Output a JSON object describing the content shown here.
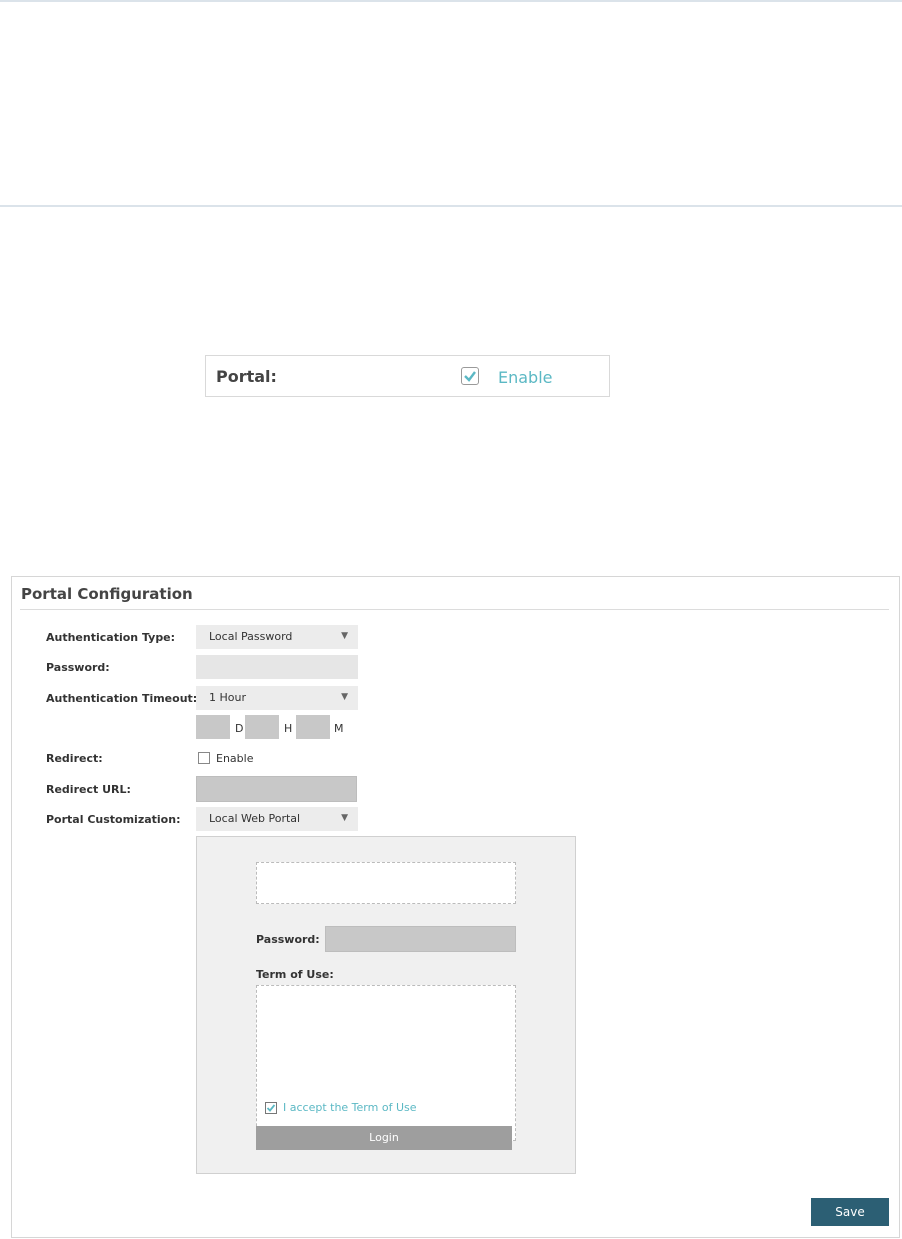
{
  "portal_toggle": {
    "label": "Portal:",
    "checkbox_label": "Enable",
    "checked": true
  },
  "config": {
    "title": "Portal Configuration",
    "fields": {
      "auth_type_label": "Authentication Type:",
      "auth_type_value": "Local Password",
      "password_label": "Password:",
      "password_value": "",
      "timeout_label": "Authentication Timeout:",
      "timeout_value": "1 Hour",
      "unit_d": "D",
      "unit_h": "H",
      "unit_m": "M",
      "redirect_label": "Redirect:",
      "redirect_checkbox_label": "Enable",
      "redirect_checked": false,
      "redirect_url_label": "Redirect URL:",
      "redirect_url_value": "",
      "portal_custom_label": "Portal Customization:",
      "portal_custom_value": "Local Web Portal"
    },
    "preview": {
      "password_label": "Password:",
      "term_label": "Term of Use:",
      "accept_label": "I accept the Term of Use",
      "accept_checked": true,
      "login_label": "Login"
    },
    "save_label": "Save"
  },
  "colors": {
    "accent": "#5bb8c4",
    "save_button": "#2c5f74",
    "rule": "#dbe3ea"
  }
}
